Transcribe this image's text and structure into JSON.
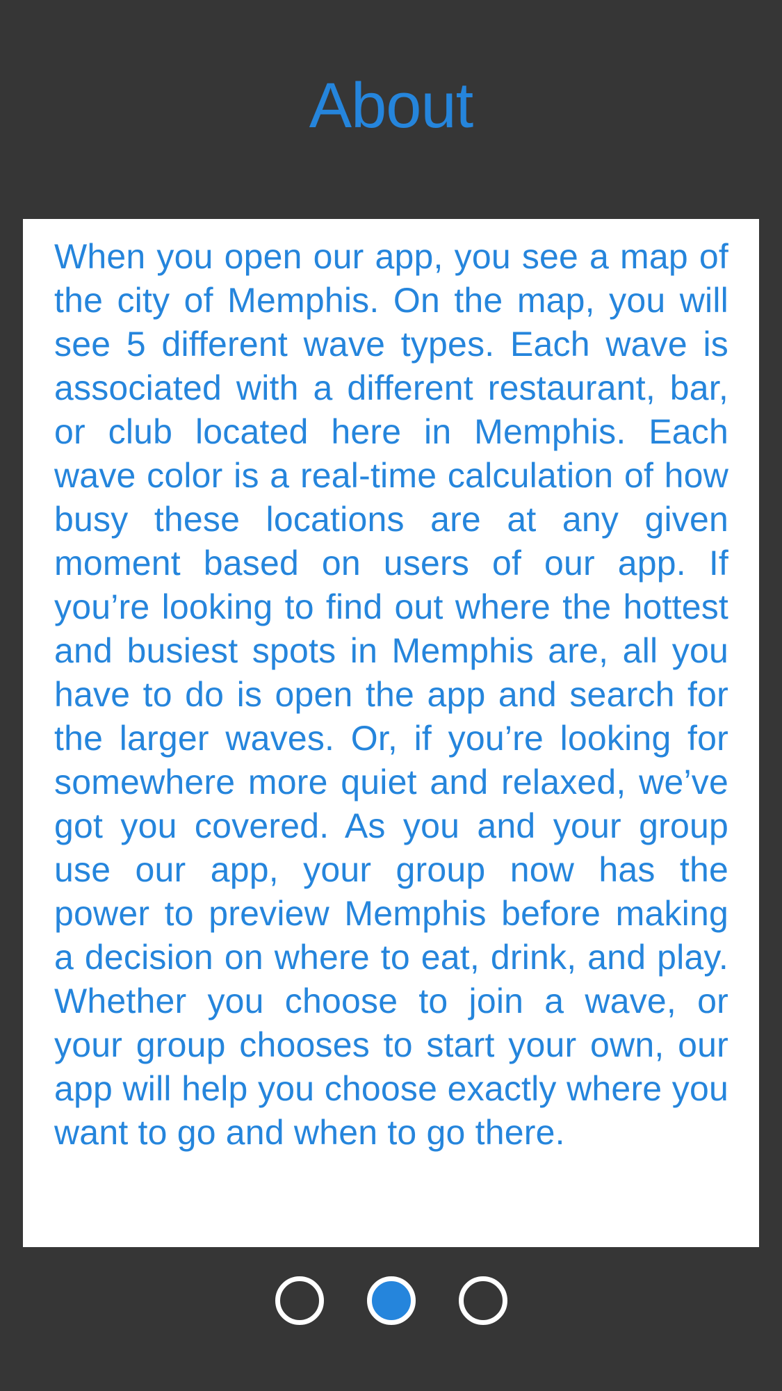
{
  "header": {
    "title": "About"
  },
  "content": {
    "text": "When you open our app, you see a map of the city of Memphis. On the map, you will see 5 different wave types. Each wave is associated with a different restaurant, bar, or club located here in Memphis. Each wave color is a real-time calculation of how busy these locations are at any given moment based on users of our app. If you’re looking to find out where the hottest and busiest spots in Memphis are, all you have to do is open the app and search for the larger waves. Or, if you’re looking for somewhere more quiet and relaxed, we’ve got you covered. As you and your group use our app, your group now has the power to preview Memphis before making a decision on where to eat, drink, and play. Whether you choose to join a wave, or your group chooses to start your own, our app will help you choose exactly where you want to go and when to go there."
  },
  "pager": {
    "page_count": 3,
    "current_page": 2
  },
  "colors": {
    "background": "#363636",
    "accent": "#2585dc",
    "card": "#ffffff",
    "dot_outline": "#ffffff"
  }
}
